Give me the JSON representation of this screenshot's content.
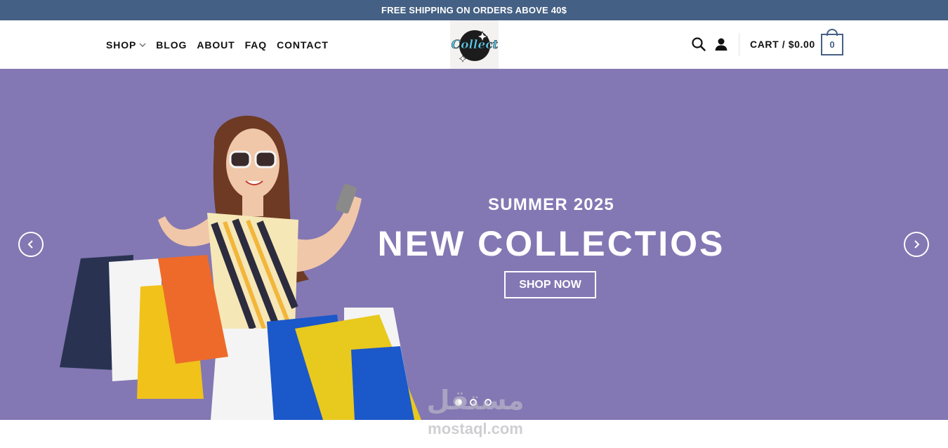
{
  "announcement": {
    "text": "FREE SHIPPING ON ORDERS ABOVE 40$"
  },
  "nav": {
    "items": [
      {
        "label": "SHOP"
      },
      {
        "label": "BLOG"
      },
      {
        "label": "ABOUT"
      },
      {
        "label": "FAQ"
      },
      {
        "label": "CONTACT"
      }
    ]
  },
  "logo": {
    "text": "Collect"
  },
  "header_tools": {
    "search_icon": "search-icon",
    "account_icon": "user-icon",
    "cart_label": "CART / $0.00",
    "cart_count": "0"
  },
  "hero": {
    "subtitle": "SUMMER 2025",
    "title": "NEW COLLECTIOS",
    "button_label": "SHOP NOW",
    "slides_total": 3,
    "active_slide": 1
  },
  "watermark": {
    "arabic": "مستقل",
    "latin": "mostaql.com"
  },
  "colors": {
    "primary": "#446084",
    "hero_bg": "#8378b3",
    "white": "#ffffff"
  }
}
